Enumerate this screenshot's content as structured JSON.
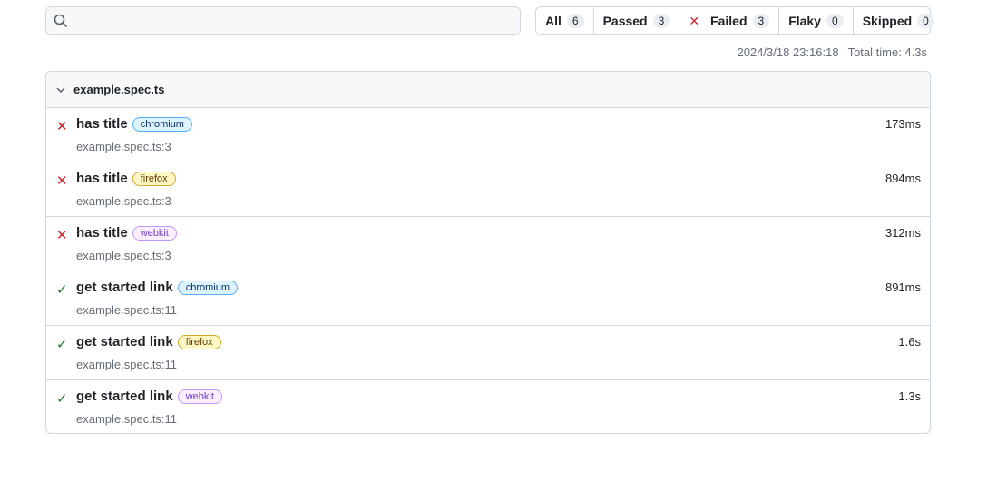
{
  "search": {
    "placeholder": "",
    "value": ""
  },
  "filters": [
    {
      "label": "All",
      "count": "6"
    },
    {
      "label": "Passed",
      "count": "3"
    },
    {
      "label": "Failed",
      "count": "3",
      "icon": "x-icon"
    },
    {
      "label": "Flaky",
      "count": "0"
    },
    {
      "label": "Skipped",
      "count": "0"
    }
  ],
  "meta": {
    "timestamp": "2024/3/18 23:16:18",
    "total_time": "Total time: 4.3s"
  },
  "file": {
    "name": "example.spec.ts",
    "tests": [
      {
        "status": "failed",
        "title": "has title",
        "project": "chromium",
        "location": "example.spec.ts:3",
        "duration": "173ms"
      },
      {
        "status": "failed",
        "title": "has title",
        "project": "firefox",
        "location": "example.spec.ts:3",
        "duration": "894ms"
      },
      {
        "status": "failed",
        "title": "has title",
        "project": "webkit",
        "location": "example.spec.ts:3",
        "duration": "312ms"
      },
      {
        "status": "passed",
        "title": "get started link",
        "project": "chromium",
        "location": "example.spec.ts:11",
        "duration": "891ms"
      },
      {
        "status": "passed",
        "title": "get started link",
        "project": "firefox",
        "location": "example.spec.ts:11",
        "duration": "1.6s"
      },
      {
        "status": "passed",
        "title": "get started link",
        "project": "webkit",
        "location": "example.spec.ts:11",
        "duration": "1.3s"
      }
    ]
  },
  "colors": {
    "failed": "#cf222e",
    "passed": "#1a7f37"
  }
}
